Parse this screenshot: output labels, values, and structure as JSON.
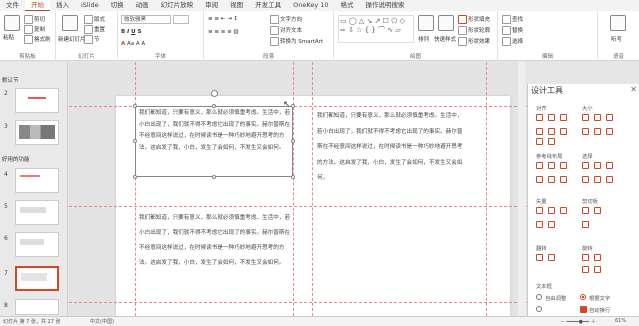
{
  "tabs": [
    "文件",
    "开始",
    "插入",
    "iSlide",
    "切换",
    "动画",
    "幻灯片放映",
    "审阅",
    "视图",
    "开发工具",
    "OneKey 10",
    "格式",
    "操作说明搜索"
  ],
  "active_tab": "开始",
  "ribbon": {
    "clipboard": {
      "paste": "粘贴",
      "cut": "剪切",
      "copy": "复制",
      "format_painter": "格式刷",
      "label": "剪贴板"
    },
    "slides": {
      "new_slide": "新建幻灯片",
      "layout": "版式",
      "reset": "重置",
      "section": "节",
      "label": "幻灯片"
    },
    "font": {
      "font_name": "微软雅黑",
      "label": "字体"
    },
    "paragraph": {
      "text_direction": "文字方向",
      "align_text": "对齐文本",
      "smartart": "转换为 SmartArt",
      "label": "段落"
    },
    "drawing": {
      "arrange": "排列",
      "quick_styles": "快速样式",
      "shape_fill": "形状填充",
      "shape_outline": "形状轮廓",
      "shape_effects": "形状效果",
      "label": "绘图"
    },
    "editing": {
      "find": "查找",
      "replace": "替换",
      "select": "选择",
      "label": "编辑"
    },
    "voice": {
      "dictate": "听写",
      "label": "语音"
    }
  },
  "left_panel": {
    "section1": "默认节",
    "section2": "好用的功能",
    "slide_numbers": [
      "2",
      "3",
      "4",
      "5",
      "6",
      "7",
      "8"
    ]
  },
  "slide_text": {
    "p1": "我们都知道，只要有意义，那么就必须慎重考虑。生活中，若小白出现了，我们就不得不考虑它出现了的事实。赫尔普斯在不经意间这样说过，在时候读书是一种巧妙地避开思考的方法。这启发了我，小白，发生了会如何，不发生又会如何。",
    "p2": "我们都知道，只要有意义，那么就必须慎重考虑。生活中，若小白出现了，我们就不得不考虑它出现了的事实。赫尔普斯在不经意间这样说过，在时候读书是一种巧妙地避开思考的方法。这启发了我，小白，发生了会如何，不发生又会如何。",
    "p3": "我们都知道，只要有意义，那么就必须慎重考虑。生活中，若小白出现了，我们就不得不考虑它出现了的事实。赫尔普斯在不经意间这样说过，在时候读书是一种巧妙地避开思考的方法。这启发了我，小白，发生了会如何，不发生又会如何。"
  },
  "design_panel": {
    "title": "设计工具",
    "align": "对齐",
    "size": "大小",
    "ref_layout": "参考线布局",
    "select": "选择",
    "rotate": "矢量",
    "crop": "剪切板",
    "flip": "翻转",
    "spin": "旋转",
    "textbox": "文本框",
    "autofit": "自由调整",
    "fit_text": "根据文字",
    "opt3": "自动换行"
  },
  "status": {
    "slide_info": "幻灯片 第 7 张，共 27 张",
    "lang": "中文(中国)",
    "zoom": "61%"
  }
}
